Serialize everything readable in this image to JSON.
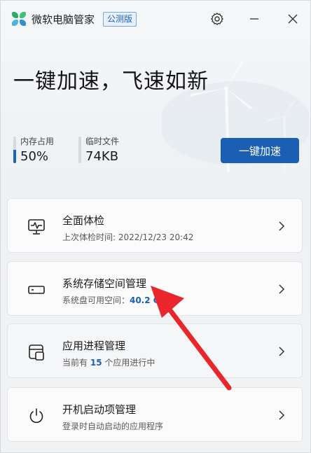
{
  "titlebar": {
    "app_name": "微软电脑管家",
    "badge": "公测版"
  },
  "hero": {
    "headline": "一键加速，飞速如新",
    "memory": {
      "label": "内存占用",
      "value": "50%",
      "fill_fraction": 0.5
    },
    "temp_files": {
      "label": "临时文件",
      "value": "74KB",
      "fill_fraction": 0.0
    },
    "boost_button": "一键加速"
  },
  "cards": [
    {
      "title": "全面体检",
      "subtitle": "上次体检时间: 2022/12/23 20:42",
      "icon": "monitor-pulse-icon"
    },
    {
      "title": "系统存储空间管理",
      "subtitle_prefix": "系统盘可用空间：",
      "subtitle_value": "40.2 GB",
      "icon": "drive-icon"
    },
    {
      "title": "应用进程管理",
      "subtitle_prefix": "当前有",
      "subtitle_value": "15",
      "subtitle_suffix": "个应用进行中",
      "icon": "app-process-icon"
    },
    {
      "title": "开机启动项管理",
      "subtitle": "登录时自动启动的应用程序",
      "icon": "power-icon"
    }
  ],
  "colors": {
    "accent": "#1a5fb4",
    "annotation_arrow": "#e8262b"
  }
}
